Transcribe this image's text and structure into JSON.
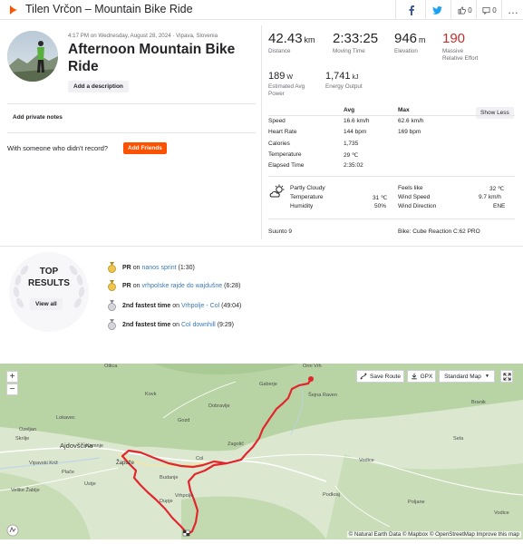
{
  "header": {
    "title": "Tilen Vrčon – Mountain Bike Ride",
    "kudos_count": "0",
    "comments_count": "0"
  },
  "activity": {
    "meta": "4:17 PM on Wednesday, August 28, 2024 · Vipava, Slovenia",
    "title_line1": "Afternoon Mountain Bike",
    "title_line2": "Ride",
    "add_description_label": "Add a description",
    "add_private_notes_label": "Add private notes",
    "with_someone_text": "With someone who didn't record?",
    "add_friends_label": "Add Friends"
  },
  "stats": {
    "distance": {
      "value": "42.43",
      "unit": "km",
      "label": "Distance"
    },
    "moving_time": {
      "value": "2:33:25",
      "label": "Moving Time"
    },
    "elevation": {
      "value": "946",
      "unit": "m",
      "label": "Elevation"
    },
    "relative_effort": {
      "value": "190",
      "label_line1": "Massive",
      "label_line2": "Relative Effort"
    },
    "power": {
      "value": "189",
      "unit": "W",
      "label_line1": "Estimated Avg",
      "label_line2": "Power"
    },
    "energy": {
      "value": "1,741",
      "unit": "kJ",
      "label": "Energy Output"
    }
  },
  "details": {
    "col_avg": "Avg",
    "col_max": "Max",
    "show_less_label": "Show Less",
    "rows": [
      {
        "label": "Speed",
        "avg": "16.6 km/h",
        "max": "62.6 km/h"
      },
      {
        "label": "Heart Rate",
        "avg": "144 bpm",
        "max": "169 bpm"
      },
      {
        "label": "Calories",
        "avg": "1,735",
        "max": ""
      },
      {
        "label": "Temperature",
        "avg": "29 ℃",
        "max": ""
      },
      {
        "label": "Elapsed Time",
        "avg": "2:35:02",
        "max": ""
      }
    ]
  },
  "weather": {
    "condition": "Partly Cloudy",
    "temperature_label": "Temperature",
    "temperature_value": "31 ℃",
    "humidity_label": "Humidity",
    "humidity_value": "50%",
    "feels_like_label": "Feels like",
    "feels_like_value": "32 ℃",
    "wind_speed_label": "Wind Speed",
    "wind_speed_value": "9.7 km/h",
    "wind_direction_label": "Wind Direction",
    "wind_direction_value": "ENE"
  },
  "device": {
    "device_name": "Suunto 9",
    "bike_label": "Bike: Cube Reaction C:62 PRO"
  },
  "top_results": {
    "title_line1": "TOP",
    "title_line2": "RESULTS",
    "view_all_label": "View all",
    "items": [
      {
        "prefix": "PR",
        "on": "on",
        "segment": "nanos sprint",
        "time": "(1:30)"
      },
      {
        "prefix": "PR",
        "on": "on",
        "segment": "vrhpolske rajde do wajdušne",
        "time": "(6:28)"
      },
      {
        "prefix": "2nd fastest time",
        "on": "on",
        "segment": "Vrhpolje - Col",
        "time": "(49:04)"
      },
      {
        "prefix": "2nd fastest time",
        "on": "on",
        "segment": "Col downhill",
        "time": "(9:29)"
      }
    ]
  },
  "map": {
    "save_route_label": "Save Route",
    "gpx_label": "GPX",
    "map_style_label": "Standard Map",
    "zoom_in": "+",
    "zoom_out": "−",
    "attribution": "© Natural Earth Data © Mapbox © OpenStreetMap Improve this map",
    "labels": [
      {
        "name": "Otlica"
      },
      {
        "name": "Kovk"
      },
      {
        "name": "Gozd"
      },
      {
        "name": "Lokavec"
      },
      {
        "name": "Skrilje"
      },
      {
        "name": "Zagolič"
      },
      {
        "name": "Vodice"
      },
      {
        "name": "Col"
      },
      {
        "name": "Budanje"
      },
      {
        "name": "Dupje"
      },
      {
        "name": "Vrhpolje"
      },
      {
        "name": "Podkraj"
      },
      {
        "name": "Vipavski Križ"
      },
      {
        "name": "Plače"
      },
      {
        "name": "Ustje"
      },
      {
        "name": "Velike Žablje"
      },
      {
        "name": "Šejna Raven"
      },
      {
        "name": "Orni Vrh"
      },
      {
        "name": "Kamnje"
      },
      {
        "name": "Ozeljan"
      },
      {
        "name": "Dobravlje"
      },
      {
        "name": "Gaberje"
      },
      {
        "name": "Sela"
      },
      {
        "name": "Branik"
      },
      {
        "name": "Poljane"
      },
      {
        "name": "Vodice"
      }
    ],
    "towns": [
      {
        "name": "Ajdovščina"
      },
      {
        "name": "Žapuže"
      }
    ]
  }
}
